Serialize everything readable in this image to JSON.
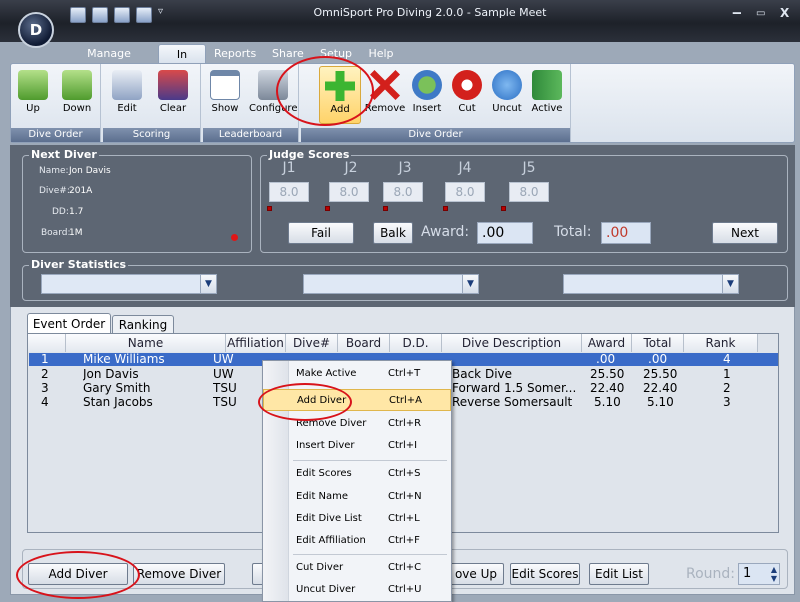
{
  "window": {
    "title": "OmniSport Pro Diving 2.0.0 - Sample Meet"
  },
  "menu_tabs": [
    "Manage Meets",
    "In Meet",
    "Reports",
    "Share",
    "Setup",
    "Help"
  ],
  "active_tab": "In Meet",
  "ribbon": {
    "groups": [
      {
        "caption": "Dive Order",
        "buttons": [
          "Up",
          "Down"
        ]
      },
      {
        "caption": "Scoring",
        "buttons": [
          "Edit",
          "Clear"
        ]
      },
      {
        "caption": "Leaderboard",
        "buttons": [
          "Show",
          "Configure"
        ]
      },
      {
        "caption": "Dive Order",
        "buttons": [
          "Add",
          "Remove",
          "Insert",
          "Cut",
          "Uncut",
          "Active"
        ]
      }
    ]
  },
  "next_diver": {
    "legend": "Next Diver",
    "name_label": "Name:",
    "name": "Jon Davis",
    "dive_label": "Dive#:",
    "dive": "201A",
    "dd_label": "DD:",
    "dd": "1.7",
    "board_label": "Board:",
    "board": "1M"
  },
  "judge_scores": {
    "legend": "Judge Scores",
    "judges": [
      "J1",
      "J2",
      "J3",
      "J4",
      "J5"
    ],
    "scores": [
      "8.0",
      "8.0",
      "8.0",
      "8.0",
      "8.0"
    ],
    "fail_label": "Fail",
    "balk_label": "Balk",
    "award_label": "Award:",
    "award_value": ".00",
    "total_label": "Total:",
    "total_value": ".00",
    "next_label": "Next"
  },
  "diver_statistics": {
    "legend": "Diver Statistics"
  },
  "list_tabs": [
    "Event Order",
    "Ranking"
  ],
  "table": {
    "columns": [
      "Name",
      "Affiliation",
      "Dive#",
      "Board",
      "D.D.",
      "Dive Description",
      "Award",
      "Total",
      "Rank"
    ],
    "rows": [
      {
        "num": "1",
        "name": "Mike Williams",
        "affiliation": "UW",
        "description": "",
        "award": ".00",
        "total": ".00",
        "rank": "4"
      },
      {
        "num": "2",
        "name": "Jon Davis",
        "affiliation": "UW",
        "description": "Back Dive",
        "award": "25.50",
        "total": "25.50",
        "rank": "1"
      },
      {
        "num": "3",
        "name": "Gary Smith",
        "affiliation": "TSU",
        "description": "Forward 1.5 Somer...",
        "award": "22.40",
        "total": "22.40",
        "rank": "2"
      },
      {
        "num": "4",
        "name": "Stan Jacobs",
        "affiliation": "TSU",
        "description": "Reverse Somersault",
        "award": "5.10",
        "total": "5.10",
        "rank": "3"
      }
    ]
  },
  "context_menu": [
    {
      "label": "Make Active",
      "shortcut": "Ctrl+T"
    },
    {
      "label": "Add Diver",
      "shortcut": "Ctrl+A"
    },
    {
      "label": "Remove Diver",
      "shortcut": "Ctrl+R"
    },
    {
      "label": "Insert Diver",
      "shortcut": "Ctrl+I"
    },
    {
      "label": "Edit Scores",
      "shortcut": "Ctrl+S"
    },
    {
      "label": "Edit Name",
      "shortcut": "Ctrl+N"
    },
    {
      "label": "Edit Dive List",
      "shortcut": "Ctrl+L"
    },
    {
      "label": "Edit Affiliation",
      "shortcut": "Ctrl+F"
    },
    {
      "label": "Cut Diver",
      "shortcut": "Ctrl+C"
    },
    {
      "label": "Uncut Diver",
      "shortcut": "Ctrl+U"
    }
  ],
  "bottom_bar": {
    "add_diver": "Add Diver",
    "remove_diver": "Remove Diver",
    "move_up": "ove Up",
    "edit_scores": "Edit Scores",
    "edit_list": "Edit List",
    "round_label": "Round:",
    "round_value": "1"
  },
  "colors": {
    "annotation": "#d8131b",
    "selection": "#2f5fb8",
    "highlight": "#ffe7a6"
  }
}
